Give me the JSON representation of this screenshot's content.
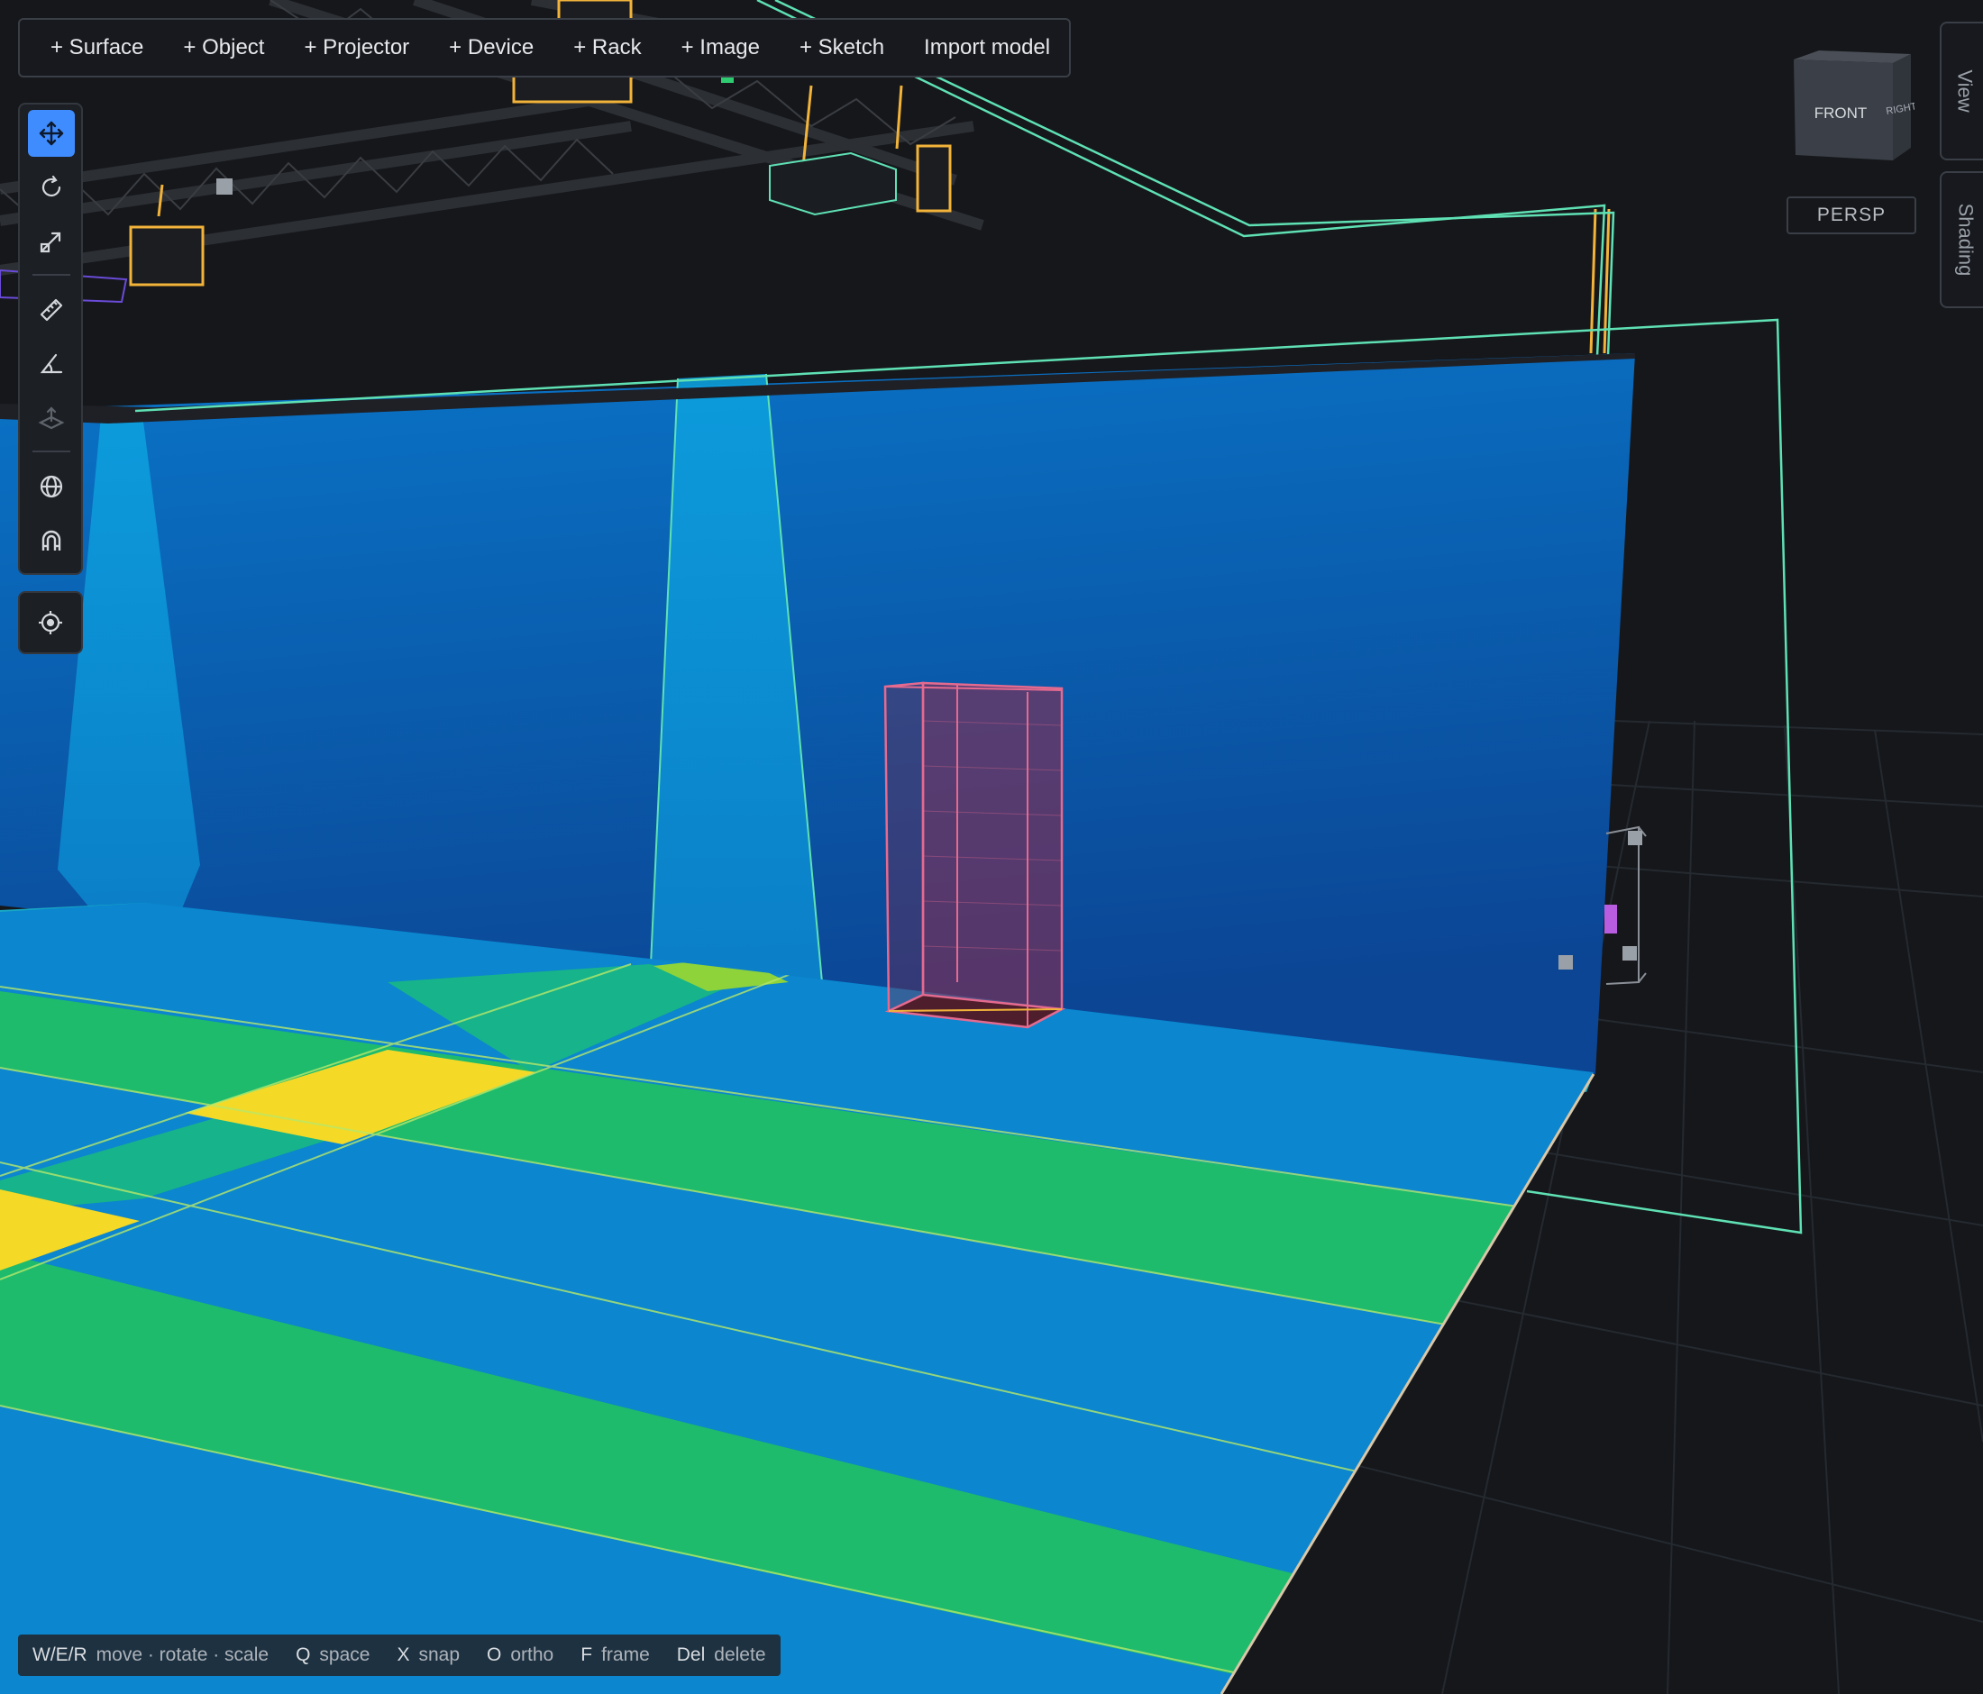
{
  "toolbar": {
    "items": [
      "+ Surface",
      "+ Object",
      "+ Projector",
      "+ Device",
      "+ Rack",
      "+ Image",
      "+ Sketch",
      "Import model"
    ]
  },
  "tools": [
    {
      "name": "move-tool",
      "icon": "move-icon",
      "active": true
    },
    {
      "name": "rotate-tool",
      "icon": "rotate-icon",
      "active": false
    },
    {
      "name": "scale-tool",
      "icon": "scale-icon",
      "active": false
    },
    {
      "name": "measure-tool",
      "icon": "ruler-icon",
      "active": false
    },
    {
      "name": "angle-tool",
      "icon": "angle-icon",
      "active": false
    },
    {
      "name": "place-on-floor-tool",
      "icon": "floor-arrow-icon",
      "active": false
    },
    {
      "name": "world-space-tool",
      "icon": "globe-icon",
      "active": false
    },
    {
      "name": "snap-tool",
      "icon": "magnet-icon",
      "active": false
    },
    {
      "name": "focus-tool",
      "icon": "crosshair-icon",
      "active": false
    }
  ],
  "navigation": {
    "cube_front": "FRONT",
    "cube_right": "RIGHT",
    "projection": "PERSP"
  },
  "side_tabs": {
    "view": "View",
    "shading": "Shading"
  },
  "statusbar": [
    {
      "key": "W/E/R",
      "action": "move · rotate · scale"
    },
    {
      "key": "Q",
      "action": "space"
    },
    {
      "key": "X",
      "action": "snap"
    },
    {
      "key": "O",
      "action": "ortho"
    },
    {
      "key": "F",
      "action": "frame"
    },
    {
      "key": "Del",
      "action": "delete"
    }
  ],
  "colors": {
    "background": "#15171b",
    "accent": "#3f8cff",
    "coverage_blue": "#0b7fca",
    "coverage_green": "#1ebb6d",
    "coverage_yellow": "#f4d927",
    "selection_outline": "#5fe1b4",
    "object_box": "#e56a8f",
    "rig_cable": "#f2b33a"
  }
}
